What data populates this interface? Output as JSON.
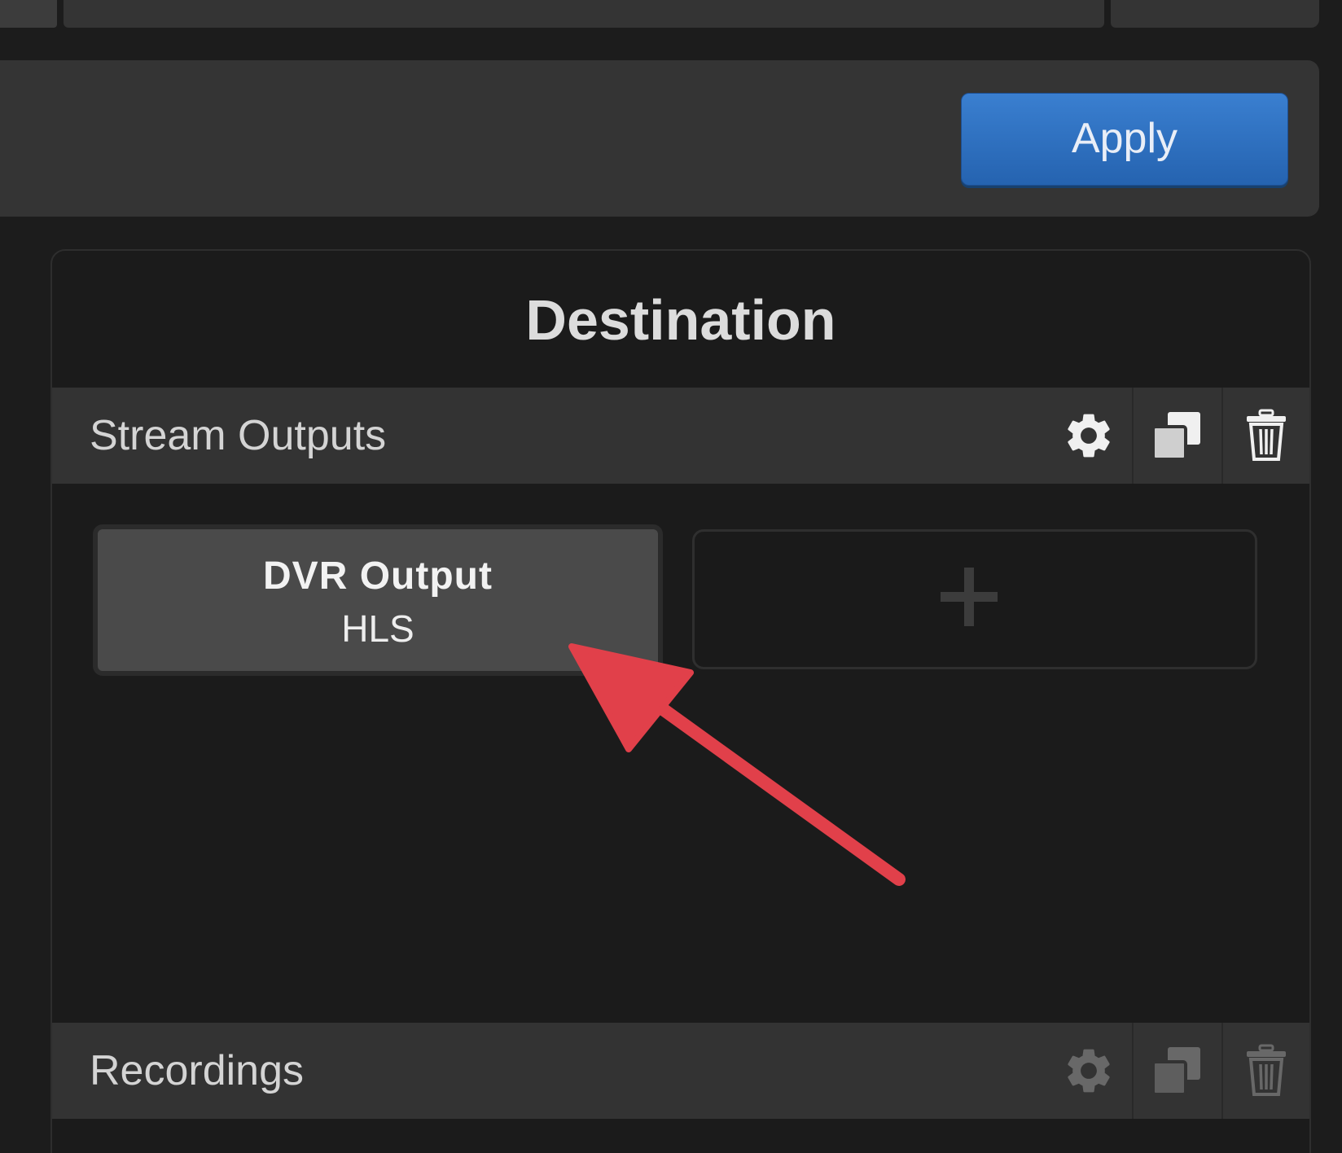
{
  "toolbar": {
    "apply_label": "Apply"
  },
  "destination": {
    "title": "Destination",
    "stream_outputs": {
      "label": "Stream Outputs",
      "tools": [
        "gear-icon",
        "duplicate-icon",
        "trash-icon"
      ],
      "outputs": [
        {
          "name": "DVR Output",
          "type": "HLS"
        }
      ],
      "add_button": "plus-icon"
    },
    "recordings": {
      "label": "Recordings",
      "tools": [
        "gear-icon",
        "duplicate-icon",
        "trash-icon"
      ],
      "tools_enabled": false
    }
  },
  "colors": {
    "apply_button": "#2f72c4",
    "annotation_arrow": "#e1404a",
    "panel_background": "#1b1b1b",
    "section_header": "#333333"
  }
}
